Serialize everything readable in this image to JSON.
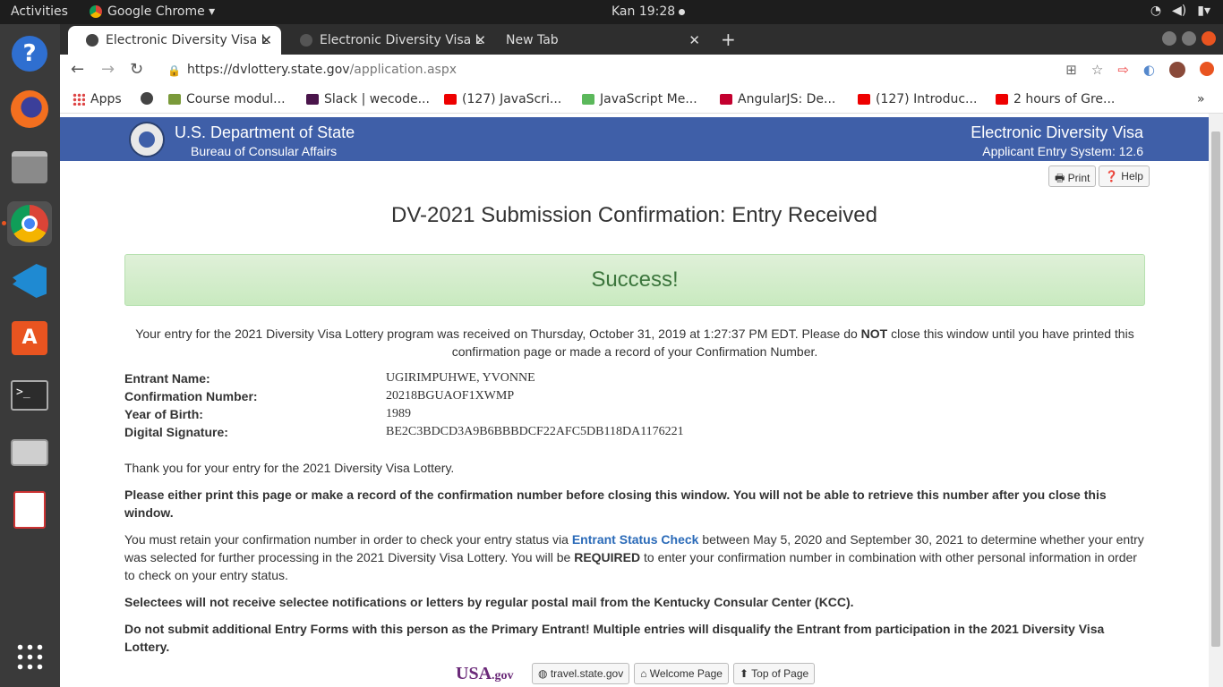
{
  "os": {
    "activities": "Activities",
    "app_menu": "Google Chrome ▾",
    "clock": "Kan 19:28"
  },
  "browser": {
    "tabs": [
      {
        "label": "Electronic Diversity Visa L",
        "close": "✕"
      },
      {
        "label": "Electronic Diversity Visa L",
        "close": "✕"
      },
      {
        "label": "New Tab",
        "close": "✕"
      }
    ],
    "url_host": "https://dvlottery.state.gov",
    "url_path": "/application.aspx",
    "bookmarks": [
      "Apps",
      "Course modul...",
      "Slack | wecode...",
      "(127) JavaScri...",
      "JavaScript Me...",
      "AngularJS: De...",
      "(127) Introduc...",
      "2 hours of Gre..."
    ]
  },
  "header": {
    "dept": "U.S. Department of State",
    "bureau": "Bureau of Consular Affairs",
    "system_title": "Electronic Diversity Visa",
    "system_version": "Applicant Entry System: 12.6"
  },
  "actions": {
    "print": "Print",
    "help": "Help"
  },
  "page": {
    "title": "DV-2021 Submission Confirmation: Entry Received",
    "success": "Success!",
    "intro_1": "Your entry for the 2021 Diversity Visa Lottery program was received on Thursday, October 31, 2019 at 1:27:37 PM EDT. Please do ",
    "intro_not": "NOT",
    "intro_2": " close this window until you have printed this confirmation page or made a record of your Confirmation Number.",
    "entrant_name_label": "Entrant Name:",
    "entrant_name": "UGIRIMPUHWE, YVONNE",
    "confirmation_label": "Confirmation Number:",
    "confirmation": "20218BGUAOF1XWMP",
    "yob_label": "Year of Birth:",
    "yob": "1989",
    "signature_label": "Digital Signature:",
    "signature": "BE2C3BDCD3A9B6BBBDCF22AFC5DB118DA1176221",
    "p1": "Thank you for your entry for the 2021 Diversity Visa Lottery.",
    "p2": "Please either print this page or make a record of the confirmation number before closing this window. You will not be able to retrieve this number after you close this window.",
    "p3_a": "You must retain your confirmation number in order to check your entry status via ",
    "p3_link": "Entrant Status Check",
    "p3_b": " between May 5, 2020 and September 30, 2021 to determine whether your entry was selected for further processing in the 2021 Diversity Visa Lottery. You will be ",
    "p3_required": "REQUIRED",
    "p3_c": " to enter your confirmation number in combination with other personal information in order to check on your entry status.",
    "p4": "Selectees will not receive selectee notifications or letters by regular postal mail from the Kentucky Consular Center (KCC).",
    "p5": "Do not submit additional Entry Forms with this person as the Primary Entrant! Multiple entries will disqualify the Entrant from participation in the 2021 Diversity Visa Lottery."
  },
  "footer": {
    "usagov": "USA",
    "usagov_suffix": ".gov",
    "travel": "travel.state.gov",
    "welcome": "Welcome Page",
    "top": "Top of Page"
  }
}
